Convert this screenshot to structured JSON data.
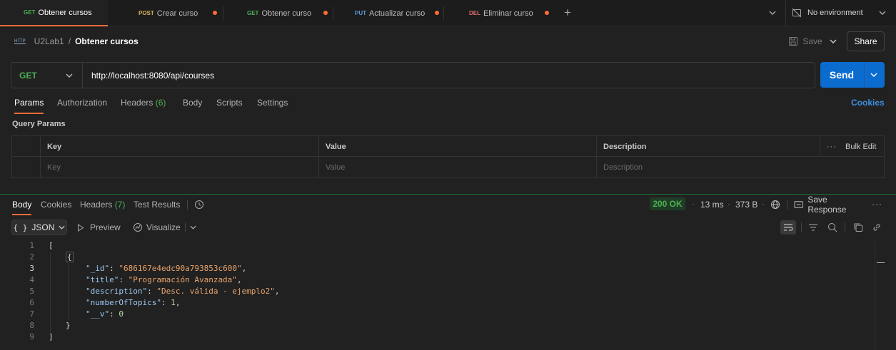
{
  "tabs": [
    {
      "method": "GET",
      "label": "Obtener cursos",
      "active": true
    },
    {
      "method": "POST",
      "label": "Crear curso",
      "active": false
    },
    {
      "method": "GET",
      "label": "Obtener curso",
      "active": false
    },
    {
      "method": "PUT",
      "label": "Actualizar curso",
      "active": false
    },
    {
      "method": "DEL",
      "label": "Eliminar curso",
      "active": false
    }
  ],
  "environment": "No environment",
  "breadcrumb": {
    "collection": "U2Lab1",
    "separator": "/",
    "request": "Obtener cursos",
    "icon_text": "HTTP"
  },
  "save_label": "Save",
  "share_label": "Share",
  "request": {
    "method": "GET",
    "url": "http://localhost:8080/api/courses",
    "send_label": "Send"
  },
  "request_tabs": {
    "params": "Params",
    "authorization": "Authorization",
    "headers": "Headers",
    "headers_count": "(6)",
    "body": "Body",
    "scripts": "Scripts",
    "settings": "Settings",
    "cookies": "Cookies"
  },
  "query_params": {
    "title": "Query Params",
    "columns": {
      "key": "Key",
      "value": "Value",
      "description": "Description"
    },
    "bulk_edit": "Bulk Edit",
    "placeholders": {
      "key": "Key",
      "value": "Value",
      "description": "Description"
    }
  },
  "response": {
    "tabs": {
      "body": "Body",
      "cookies": "Cookies",
      "headers": "Headers",
      "headers_count": "(7)",
      "test_results": "Test Results"
    },
    "status": "200 OK",
    "time": "13 ms",
    "size": "373 B",
    "save_response": "Save Response",
    "format": "JSON",
    "preview": "Preview",
    "visualize": "Visualize",
    "body_lines": [
      {
        "n": "1",
        "text": "["
      },
      {
        "n": "2",
        "text": "    {"
      },
      {
        "n": "3",
        "key": "\"_id\"",
        "val": "\"686167e4edc90a793853c600\"",
        "type": "s"
      },
      {
        "n": "4",
        "key": "\"title\"",
        "val": "\"Programación Avanzada\"",
        "type": "s"
      },
      {
        "n": "5",
        "key": "\"description\"",
        "val": "\"Desc. válida - ejemplo2\"",
        "type": "s"
      },
      {
        "n": "6",
        "key": "\"numberOfTopics\"",
        "val": "1",
        "type": "n"
      },
      {
        "n": "7",
        "key": "\"__v\"",
        "val": "0",
        "type": "n",
        "last": true
      },
      {
        "n": "8",
        "text": "    }"
      },
      {
        "n": "9",
        "text": "]"
      }
    ]
  },
  "colors": {
    "accent": "#ff6c37",
    "send": "#0b6cd0",
    "get": "#4caf50",
    "post": "#d4b45e",
    "put": "#5b9bd5",
    "del": "#e06c6c",
    "status_ok": "#4caf50"
  }
}
